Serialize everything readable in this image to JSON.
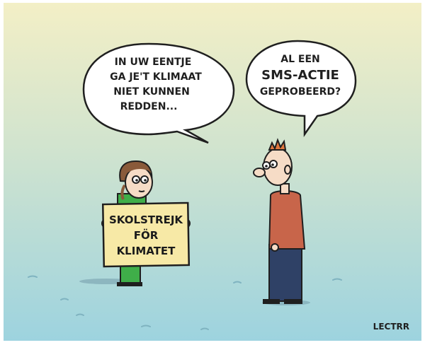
{
  "comic": {
    "speech_left": [
      "IN UW EENTJE",
      "GA JE'T KLIMAAT",
      "NIET KUNNEN",
      "REDDEN..."
    ],
    "speech_right": [
      "AL EEN",
      "SMS-ACTIE",
      "GEPROBEERD?"
    ],
    "sign": [
      "SKOLSTREJK",
      "FÖR",
      "KLIMATET"
    ],
    "signature": "LECTRR"
  },
  "colors": {
    "sky_top": "#f3efc6",
    "sky_bottom": "#9dd3df",
    "girl_outfit": "#3fae49",
    "man_sweater": "#c8654a",
    "man_trousers": "#2f4166",
    "sign_board": "#f7e9a6"
  }
}
